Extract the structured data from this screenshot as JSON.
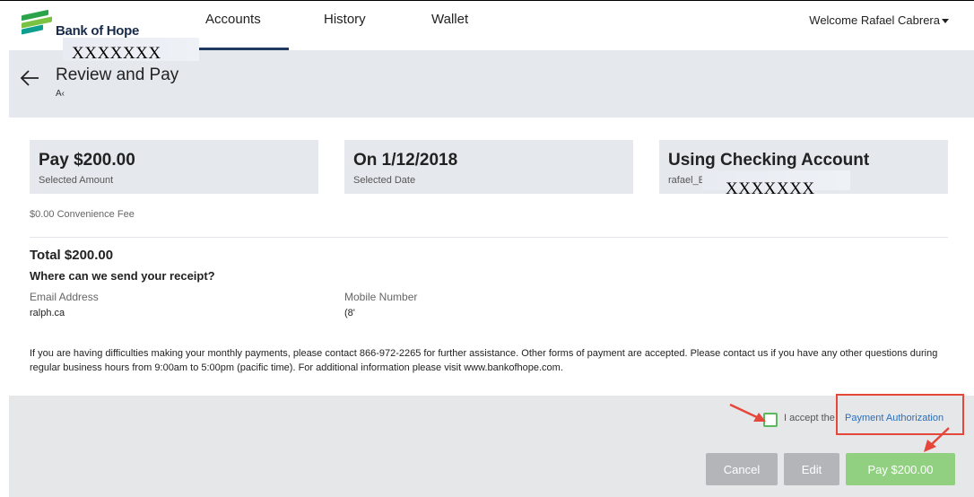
{
  "nav": {
    "logo_text": "Bank of Hope",
    "tabs": [
      "Accounts",
      "History",
      "Wallet"
    ],
    "active_tab": "Accounts",
    "welcome": "Welcome Rafael Cabrera"
  },
  "header": {
    "title": "Review and Pay",
    "account_prefix": "A‹",
    "account_mask": "XXXXXXX"
  },
  "cards": [
    {
      "title": "Pay $200.00",
      "subtitle": "Selected Amount"
    },
    {
      "title": "On 1/12/2018",
      "subtitle": "Selected Date"
    },
    {
      "title": "Using Checking Account",
      "subtitle": "rafael_E",
      "mask": "XXXXXXX"
    }
  ],
  "convenience_fee": "$0.00 Convenience Fee",
  "total": "Total $200.00",
  "receipt": {
    "question": "Where can we send your receipt?",
    "email_label": "Email Address",
    "email_value": "ralph.ca",
    "mobile_label": "Mobile Number",
    "mobile_value": "(8'"
  },
  "disclaimer": "If you are having difficulties making your monthly payments, please contact 866-972-2265 for further assistance. Other forms of payment are accepted.  Please contact us if you have any other questions during regular business hours from 9:00am to 5:00pm (pacific time). For additional information please visit www.bankofhope.com.",
  "footer": {
    "accept_text": "I accept the",
    "auth_link": "Payment Authorization",
    "accepted": false,
    "cancel": "Cancel",
    "edit": "Edit",
    "pay": "Pay $200.00"
  },
  "colors": {
    "accent_navy": "#1e3a5f",
    "pay_button": "#90d080",
    "disabled_button": "#b3b5b8",
    "annotation_red": "#e5473b",
    "link_blue": "#2a6ebb"
  }
}
